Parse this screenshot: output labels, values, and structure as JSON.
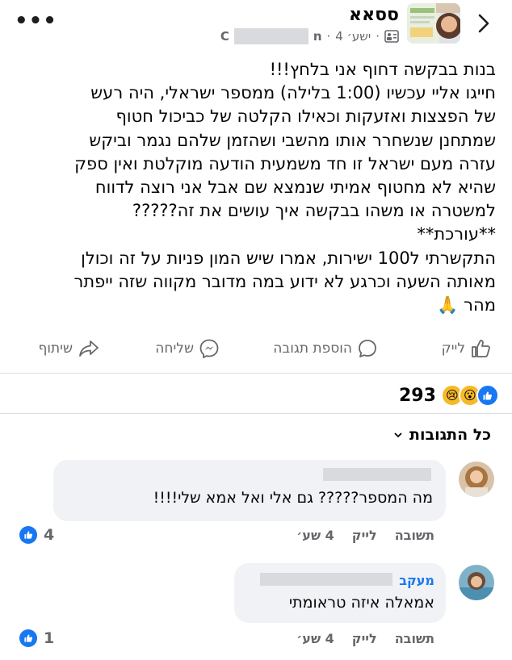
{
  "header": {
    "author": "ססאא",
    "time": "4 ישע׳",
    "partial_name_left": "C",
    "partial_name_right": "n"
  },
  "post": {
    "lines": [
      "בנות בבקשה דחוף אני בלחץ!!!",
      "חייגו אליי עכשיו (1:00 בלילה) ממספר ישראלי, היה רעש",
      "של הפצצות ואזעקות וכאילו הקלטה של כביכול חטוף",
      "שמתחנן שנשחרר אותו מהשבי ושהזמן שלהם נגמר וביקש",
      "עזרה מעם ישראל זו חד משמעית הודעה מוקלטת ואין ספק",
      "שהיא לא מחטוף אמיתי שנמצא שם אבל אני רוצה לדווח",
      "למשטרה או משהו בבקשה איך עושים את זה?????",
      "**עורכת**",
      "התקשרתי ל100 ישירות, אמרו שיש המון פניות על זה וכולן",
      "מאותה השעה וכרגע לא ידוע במה מדובר מקווה שזה ייפתר",
      "מהר 🙏"
    ]
  },
  "actions": {
    "like": "לייק",
    "comment": "הוספת תגובה",
    "send": "שליחה",
    "share": "שיתוף"
  },
  "reactions": {
    "count": "293",
    "emojis": [
      "😢",
      "😮",
      "👍"
    ]
  },
  "comments_filter": "כל התגובות",
  "comments": [
    {
      "name": "",
      "text": "מה המספר????? גם אלי ואל אמא שלי!!!!",
      "time": "4 שע׳",
      "like": "לייק",
      "reply": "תשובה",
      "likes": "4"
    },
    {
      "name": "מעקב",
      "text": "אמאלה איזה טראומתי",
      "time": "4 שע׳",
      "like": "לייק",
      "reply": "תשובה",
      "likes": "1"
    }
  ],
  "colors": {
    "accent": "#1877f2",
    "secondary_text": "#65676b",
    "bubble": "#f0f2f5"
  }
}
